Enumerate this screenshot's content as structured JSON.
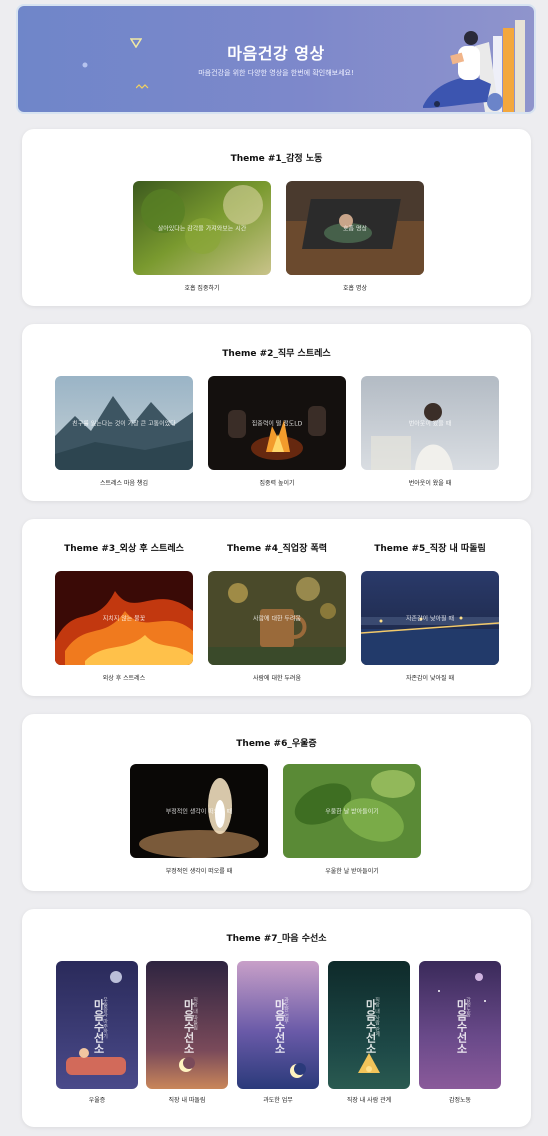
{
  "banner": {
    "title": "마음건강 영상",
    "subtitle": "마음건강을 위한 다양한 영상을 한번에 확인해보세요!"
  },
  "themes": [
    {
      "title": "Theme #1_감정 노동",
      "videos": [
        {
          "caption": "호흡 집중하기",
          "overlay": "살아있다는 감각을 가져와보는 시간"
        },
        {
          "caption": "호흡 명상",
          "overlay": "호흡 명상"
        }
      ]
    },
    {
      "title": "Theme #2_직무 스트레스",
      "videos": [
        {
          "caption": "스트레스 마음 챙김",
          "overlay": "친구를 잃는다는 것이 가장 큰 고통이었다"
        },
        {
          "caption": "집중력 높이기",
          "overlay": "집중력이 떨 정도LD"
        },
        {
          "caption": "번아웃이 왔을 때",
          "overlay": "번아웃이 왔을 때"
        }
      ]
    },
    {
      "title": "Theme #3_외상 후 스트레스",
      "videos": [
        {
          "caption": "외상 후 스트레스",
          "overlay": "지치지 않는 불꽃"
        }
      ]
    },
    {
      "title": "Theme #4_직업장 폭력",
      "videos": [
        {
          "caption": "사람에 대한 두려움",
          "overlay": "사람에 대한 두려움"
        }
      ]
    },
    {
      "title": "Theme #5_직장 내 따돌림",
      "videos": [
        {
          "caption": "자존감이 낮아질 때",
          "overlay": "자존감이 낮아질 때"
        }
      ]
    },
    {
      "title": "Theme #6_우울증",
      "videos": [
        {
          "caption": "부정적인 생각이 떠오를 때",
          "overlay": "부정적인 생각이 떠오를 때"
        },
        {
          "caption": "우울한 날 받아들이기",
          "overlay": "우울한 날 받아들이기"
        }
      ]
    },
    {
      "title": "Theme #7_마음 수선소",
      "videos": [
        {
          "caption": "우울증",
          "poster_title": "마음수선소",
          "poster_sub": "우울증과 마주하기"
        },
        {
          "caption": "직장 내 따돌림",
          "poster_title": "마음수선소",
          "poster_sub": "직장 내 따돌림"
        },
        {
          "caption": "과도한 업무",
          "poster_title": "마음수선소",
          "poster_sub": "과도한 업무"
        },
        {
          "caption": "직장 내 사람 관계",
          "poster_title": "마음수선소",
          "poster_sub": "직장 내 사람 관계"
        },
        {
          "caption": "감정노동",
          "poster_title": "마음수선소",
          "poster_sub": "감정노동"
        }
      ]
    }
  ],
  "colors": {
    "banner": "#7b88cc",
    "card": "#ffffff",
    "background": "#ededf0"
  }
}
